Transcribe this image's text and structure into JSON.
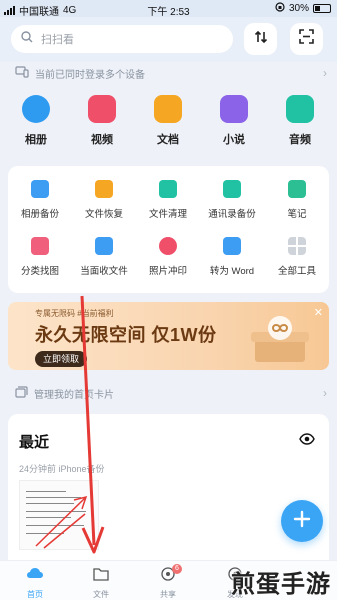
{
  "status_bar": {
    "carrier": "中国联通",
    "network": "4G",
    "time": "下午 2:53",
    "battery": "30%"
  },
  "top": {
    "search_placeholder": "扫扫看",
    "sort_icon": "sort-icon",
    "scan_icon": "scan-icon"
  },
  "devices_bar": {
    "text": "当前已同时登录多个设备"
  },
  "categories": [
    {
      "label": "相册",
      "icon": "album-icon",
      "color": "#2f9bf0"
    },
    {
      "label": "视频",
      "icon": "video-icon",
      "color": "#f04f6a"
    },
    {
      "label": "文档",
      "icon": "document-icon",
      "color": "#f5a623"
    },
    {
      "label": "小说",
      "icon": "novel-icon",
      "color": "#8a63e8"
    },
    {
      "label": "音频",
      "icon": "audio-icon",
      "color": "#21c2a4"
    }
  ],
  "tools": [
    {
      "label": "相册备份",
      "icon": "album-backup-icon",
      "color": "#3d9df2"
    },
    {
      "label": "文件恢复",
      "icon": "file-restore-icon",
      "color": "#f5a623"
    },
    {
      "label": "文件清理",
      "icon": "file-clean-icon",
      "color": "#21c2a4"
    },
    {
      "label": "通讯录备份",
      "icon": "contacts-backup-icon",
      "color": "#21c2a4"
    },
    {
      "label": "笔记",
      "icon": "notes-icon",
      "color": "#2bbf93"
    },
    {
      "label": "分类找图",
      "icon": "find-photo-icon",
      "color": "#f0607c"
    },
    {
      "label": "当面收文件",
      "icon": "receive-file-icon",
      "color": "#3d9df2"
    },
    {
      "label": "照片冲印",
      "icon": "photo-print-icon",
      "color": "#f04f6a"
    },
    {
      "label": "转为 Word",
      "icon": "word-convert-icon",
      "color": "#3d9df2"
    },
    {
      "label": "全部工具",
      "icon": "all-tools-icon",
      "color": "#cfd4da"
    }
  ],
  "banner": {
    "tag": "专属无限码  #当前福利",
    "headline": "永久无限空间 仅1W份",
    "cta": "立即领取",
    "close_icon": "close-icon"
  },
  "manage_bar": {
    "text": "管理我的首页卡片"
  },
  "recent": {
    "title": "最近",
    "subtitle": "24分钟前 iPhone备份",
    "eye_icon": "eye-icon"
  },
  "tabbar": [
    {
      "label": "首页",
      "icon": "home-icon",
      "active": true
    },
    {
      "label": "文件",
      "icon": "folder-icon",
      "active": false
    },
    {
      "label": "共享",
      "icon": "share-icon",
      "active": false,
      "badge": "6"
    },
    {
      "label": "发现",
      "icon": "discover-icon",
      "active": false
    }
  ],
  "watermark": "煎蛋手游",
  "accent": "#3aa5f5"
}
